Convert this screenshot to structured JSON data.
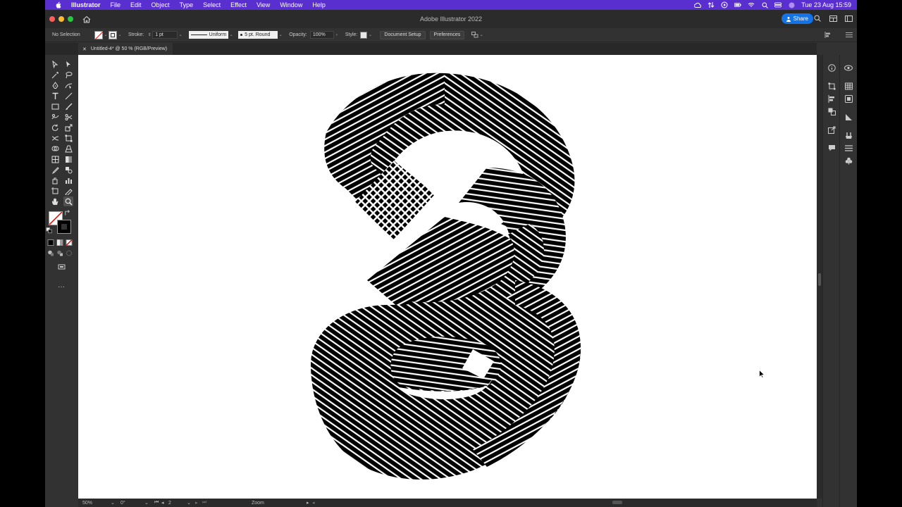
{
  "menubar": {
    "app_name": "Illustrator",
    "items": [
      "File",
      "Edit",
      "Object",
      "Type",
      "Select",
      "Effect",
      "View",
      "Window",
      "Help"
    ],
    "clock": "Tue 23 Aug  15:59"
  },
  "titlebar": {
    "title": "Adobe Illustrator 2022",
    "share_label": "Share"
  },
  "controlbar": {
    "selection_text": "No Selection",
    "stroke_label": "Stroke:",
    "stroke_weight": "1 pt",
    "stroke_type": "Uniform",
    "brush_profile": "5 pt. Round",
    "opacity_label": "Opacity:",
    "opacity_value": "100%",
    "style_label": "Style:",
    "document_setup_label": "Document Setup",
    "preferences_label": "Preferences"
  },
  "document_tab": {
    "label": "Untitled-4* @ 50 % (RGB/Preview)"
  },
  "statusbar": {
    "zoom": "50%",
    "rotation": "0°",
    "artboard_number": "2",
    "tool_name": "Zoom"
  },
  "colors": {
    "menubar_bg": "#5a2fd0",
    "share_bg": "#1473e6",
    "artwork": "#000000"
  }
}
